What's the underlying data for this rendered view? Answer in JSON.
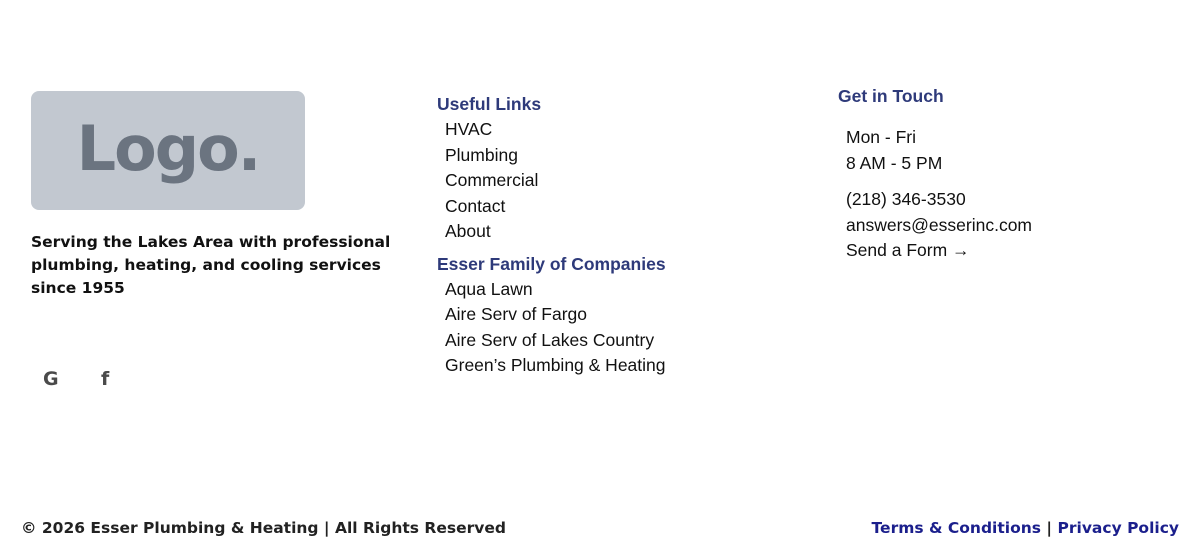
{
  "brand": {
    "logo_text": "Logo.",
    "tagline": "Serving the Lakes Area with professional plumbing, heating, and cooling services since 1955"
  },
  "social": [
    {
      "icon": "google-icon",
      "glyph": "G"
    },
    {
      "icon": "facebook-icon",
      "glyph": "f"
    }
  ],
  "useful_links": {
    "heading": "Useful Links",
    "items": [
      "HVAC",
      "Plumbing",
      "Commercial",
      "Contact",
      "About"
    ]
  },
  "family": {
    "heading": "Esser Family of Companies",
    "items": [
      "Aqua Lawn",
      "Aire Serv of Fargo",
      "Aire Serv of Lakes Country",
      "Green’s Plumbing & Heating"
    ]
  },
  "contact": {
    "heading": "Get in Touch",
    "days": "Mon - Fri",
    "hours": "8 AM - 5 PM",
    "phone": "(218) 346-3530",
    "email": "answers@esserinc.com",
    "form_link": "Send a Form →"
  },
  "footer": {
    "copyright": "© 2026 Esser Plumbing & Heating | All Rights Reserved",
    "terms": "Terms & Conditions",
    "separator": "|",
    "privacy": "Privacy Policy"
  },
  "colors": {
    "heading": "#2e3a7a",
    "legal_link": "#1b1f8c",
    "logo_bg": "#c2c8d0"
  }
}
